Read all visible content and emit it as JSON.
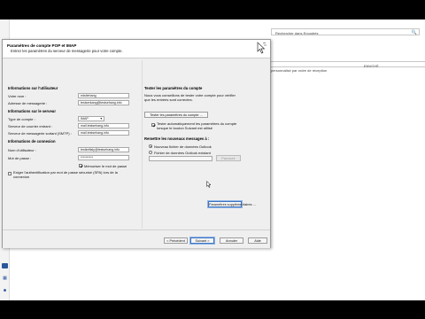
{
  "background": {
    "search_placeholder": "Rechercher dans Encadrés",
    "column_label": "ENVOYÉ",
    "header_text": "personnalisé par ordre de réception"
  },
  "dialog": {
    "title": "Paramètres de compte POP et IMAP",
    "subtitle": "Entrez les paramètres du serveur de messagerie pour votre compte.",
    "user_info": {
      "heading": "Informations sur l'utilisateur",
      "name_label": "Votre nom :",
      "name_value": "edsitehang",
      "email_label": "Adresse de messagerie :",
      "email_value": "testserkang@testsehang.info"
    },
    "server_info": {
      "heading": "Informations sur le serveur",
      "account_type_label": "Type de compte :",
      "account_type_value": "IMAP",
      "incoming_label": "Serveur de courrier entrant :",
      "incoming_value": "mail.testsehang.info",
      "outgoing_label": "Serveur de messagerie sortant (SMTP) :",
      "outgoing_value": "mail.testsehang.info"
    },
    "login_info": {
      "heading": "Informations de connexion",
      "username_label": "Nom d'utilisateur :",
      "username_value": "testkefialy@testsehang.info",
      "password_label": "Mot de passe :",
      "password_value": "**********",
      "remember_label": "Mémoriser le mot de passe",
      "remember_checked": true,
      "spa_label": "Exiger l'authentification par mot de passe sécurisé (SPA) lors de la connexion",
      "spa_checked": false
    },
    "test": {
      "heading": "Tester les paramètres du compte",
      "description": "Nous vous conseillons de tester votre compte pour vérifier que les entrées sont correctes.",
      "test_button": "Tester les paramètres du compte ...",
      "auto_test_label": "Tester automatiquement les paramètres du compte lorsque le bouton Suivant est utilisé",
      "auto_test_checked": true
    },
    "delivery": {
      "heading": "Remettre les nouveaux messages à :",
      "new_file_label": "Nouveau fichier de données Outlook",
      "existing_file_label": "Fichier de données Outlook existant",
      "browse_button": "Parcourir"
    },
    "more_settings_button": "Paramètres supplémentaires ...",
    "footer": {
      "back_button": "< Précédent",
      "next_button": "Suivant >",
      "cancel_button": "Annuler",
      "help_button": "Aide"
    }
  }
}
